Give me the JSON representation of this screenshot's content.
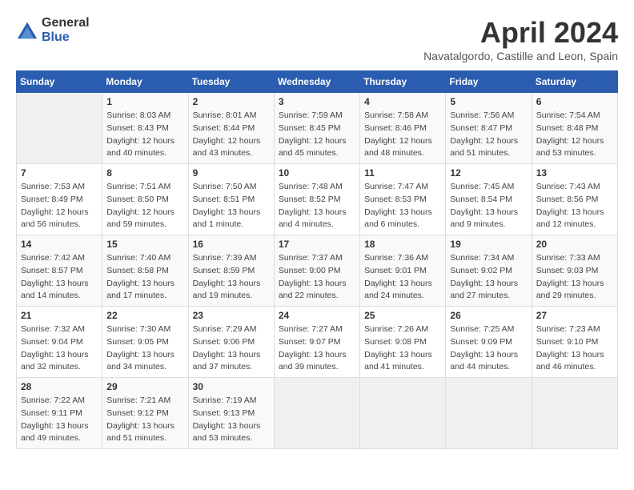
{
  "logo": {
    "general": "General",
    "blue": "Blue"
  },
  "title": {
    "month": "April 2024",
    "location": "Navatalgordo, Castille and Leon, Spain"
  },
  "weekdays": [
    "Sunday",
    "Monday",
    "Tuesday",
    "Wednesday",
    "Thursday",
    "Friday",
    "Saturday"
  ],
  "weeks": [
    [
      {
        "day": "",
        "sunrise": "",
        "sunset": "",
        "daylight": ""
      },
      {
        "day": "1",
        "sunrise": "Sunrise: 8:03 AM",
        "sunset": "Sunset: 8:43 PM",
        "daylight": "Daylight: 12 hours and 40 minutes."
      },
      {
        "day": "2",
        "sunrise": "Sunrise: 8:01 AM",
        "sunset": "Sunset: 8:44 PM",
        "daylight": "Daylight: 12 hours and 43 minutes."
      },
      {
        "day": "3",
        "sunrise": "Sunrise: 7:59 AM",
        "sunset": "Sunset: 8:45 PM",
        "daylight": "Daylight: 12 hours and 45 minutes."
      },
      {
        "day": "4",
        "sunrise": "Sunrise: 7:58 AM",
        "sunset": "Sunset: 8:46 PM",
        "daylight": "Daylight: 12 hours and 48 minutes."
      },
      {
        "day": "5",
        "sunrise": "Sunrise: 7:56 AM",
        "sunset": "Sunset: 8:47 PM",
        "daylight": "Daylight: 12 hours and 51 minutes."
      },
      {
        "day": "6",
        "sunrise": "Sunrise: 7:54 AM",
        "sunset": "Sunset: 8:48 PM",
        "daylight": "Daylight: 12 hours and 53 minutes."
      }
    ],
    [
      {
        "day": "7",
        "sunrise": "Sunrise: 7:53 AM",
        "sunset": "Sunset: 8:49 PM",
        "daylight": "Daylight: 12 hours and 56 minutes."
      },
      {
        "day": "8",
        "sunrise": "Sunrise: 7:51 AM",
        "sunset": "Sunset: 8:50 PM",
        "daylight": "Daylight: 12 hours and 59 minutes."
      },
      {
        "day": "9",
        "sunrise": "Sunrise: 7:50 AM",
        "sunset": "Sunset: 8:51 PM",
        "daylight": "Daylight: 13 hours and 1 minute."
      },
      {
        "day": "10",
        "sunrise": "Sunrise: 7:48 AM",
        "sunset": "Sunset: 8:52 PM",
        "daylight": "Daylight: 13 hours and 4 minutes."
      },
      {
        "day": "11",
        "sunrise": "Sunrise: 7:47 AM",
        "sunset": "Sunset: 8:53 PM",
        "daylight": "Daylight: 13 hours and 6 minutes."
      },
      {
        "day": "12",
        "sunrise": "Sunrise: 7:45 AM",
        "sunset": "Sunset: 8:54 PM",
        "daylight": "Daylight: 13 hours and 9 minutes."
      },
      {
        "day": "13",
        "sunrise": "Sunrise: 7:43 AM",
        "sunset": "Sunset: 8:56 PM",
        "daylight": "Daylight: 13 hours and 12 minutes."
      }
    ],
    [
      {
        "day": "14",
        "sunrise": "Sunrise: 7:42 AM",
        "sunset": "Sunset: 8:57 PM",
        "daylight": "Daylight: 13 hours and 14 minutes."
      },
      {
        "day": "15",
        "sunrise": "Sunrise: 7:40 AM",
        "sunset": "Sunset: 8:58 PM",
        "daylight": "Daylight: 13 hours and 17 minutes."
      },
      {
        "day": "16",
        "sunrise": "Sunrise: 7:39 AM",
        "sunset": "Sunset: 8:59 PM",
        "daylight": "Daylight: 13 hours and 19 minutes."
      },
      {
        "day": "17",
        "sunrise": "Sunrise: 7:37 AM",
        "sunset": "Sunset: 9:00 PM",
        "daylight": "Daylight: 13 hours and 22 minutes."
      },
      {
        "day": "18",
        "sunrise": "Sunrise: 7:36 AM",
        "sunset": "Sunset: 9:01 PM",
        "daylight": "Daylight: 13 hours and 24 minutes."
      },
      {
        "day": "19",
        "sunrise": "Sunrise: 7:34 AM",
        "sunset": "Sunset: 9:02 PM",
        "daylight": "Daylight: 13 hours and 27 minutes."
      },
      {
        "day": "20",
        "sunrise": "Sunrise: 7:33 AM",
        "sunset": "Sunset: 9:03 PM",
        "daylight": "Daylight: 13 hours and 29 minutes."
      }
    ],
    [
      {
        "day": "21",
        "sunrise": "Sunrise: 7:32 AM",
        "sunset": "Sunset: 9:04 PM",
        "daylight": "Daylight: 13 hours and 32 minutes."
      },
      {
        "day": "22",
        "sunrise": "Sunrise: 7:30 AM",
        "sunset": "Sunset: 9:05 PM",
        "daylight": "Daylight: 13 hours and 34 minutes."
      },
      {
        "day": "23",
        "sunrise": "Sunrise: 7:29 AM",
        "sunset": "Sunset: 9:06 PM",
        "daylight": "Daylight: 13 hours and 37 minutes."
      },
      {
        "day": "24",
        "sunrise": "Sunrise: 7:27 AM",
        "sunset": "Sunset: 9:07 PM",
        "daylight": "Daylight: 13 hours and 39 minutes."
      },
      {
        "day": "25",
        "sunrise": "Sunrise: 7:26 AM",
        "sunset": "Sunset: 9:08 PM",
        "daylight": "Daylight: 13 hours and 41 minutes."
      },
      {
        "day": "26",
        "sunrise": "Sunrise: 7:25 AM",
        "sunset": "Sunset: 9:09 PM",
        "daylight": "Daylight: 13 hours and 44 minutes."
      },
      {
        "day": "27",
        "sunrise": "Sunrise: 7:23 AM",
        "sunset": "Sunset: 9:10 PM",
        "daylight": "Daylight: 13 hours and 46 minutes."
      }
    ],
    [
      {
        "day": "28",
        "sunrise": "Sunrise: 7:22 AM",
        "sunset": "Sunset: 9:11 PM",
        "daylight": "Daylight: 13 hours and 49 minutes."
      },
      {
        "day": "29",
        "sunrise": "Sunrise: 7:21 AM",
        "sunset": "Sunset: 9:12 PM",
        "daylight": "Daylight: 13 hours and 51 minutes."
      },
      {
        "day": "30",
        "sunrise": "Sunrise: 7:19 AM",
        "sunset": "Sunset: 9:13 PM",
        "daylight": "Daylight: 13 hours and 53 minutes."
      },
      {
        "day": "",
        "sunrise": "",
        "sunset": "",
        "daylight": ""
      },
      {
        "day": "",
        "sunrise": "",
        "sunset": "",
        "daylight": ""
      },
      {
        "day": "",
        "sunrise": "",
        "sunset": "",
        "daylight": ""
      },
      {
        "day": "",
        "sunrise": "",
        "sunset": "",
        "daylight": ""
      }
    ]
  ]
}
